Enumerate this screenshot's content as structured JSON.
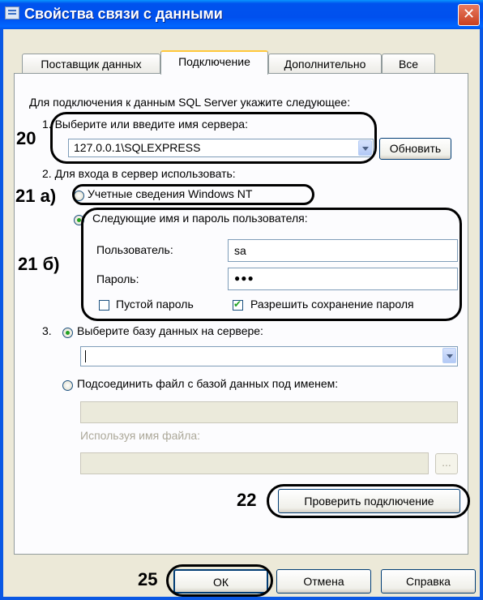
{
  "window": {
    "title": "Свойства связи с данными",
    "close_glyph": "✕"
  },
  "tabs": [
    {
      "label": "Поставщик данных"
    },
    {
      "label": "Подключение"
    },
    {
      "label": "Дополнительно"
    },
    {
      "label": "Все"
    }
  ],
  "intro": "Для подключения к данным SQL Server укажите следующее:",
  "step1": {
    "label": "1. Выберите или введите имя сервера:",
    "server_value": "127.0.0.1\\SQLEXPRESS",
    "refresh_label": "Обновить"
  },
  "step2": {
    "label": "2. Для входа в сервер использовать:",
    "windows_nt_label": "Учетные сведения Windows NT",
    "user_pass_label": "Следующие имя и пароль пользователя:",
    "user_label": "Пользователь:",
    "user_value": "sa",
    "password_label": "Пароль:",
    "password_value": "●●●",
    "blank_password_label": "Пустой пароль",
    "allow_save_label": "Разрешить сохранение пароля"
  },
  "step3": {
    "label": "3.",
    "select_db_label": "Выберите базу данных на сервере:",
    "db_value": "",
    "attach_label": "Подсоединить файл с базой данных под именем:",
    "use_filename_label": "Используя имя файла:",
    "browse_label": "..."
  },
  "test_button_label": "Проверить подключение",
  "footer": {
    "ok_label": "ОК",
    "cancel_label": "Отмена",
    "help_label": "Справка"
  },
  "annotations": {
    "a20": "20",
    "a21a": "21 а)",
    "a21b": "21 б)",
    "a22": "22",
    "a25": "25"
  }
}
